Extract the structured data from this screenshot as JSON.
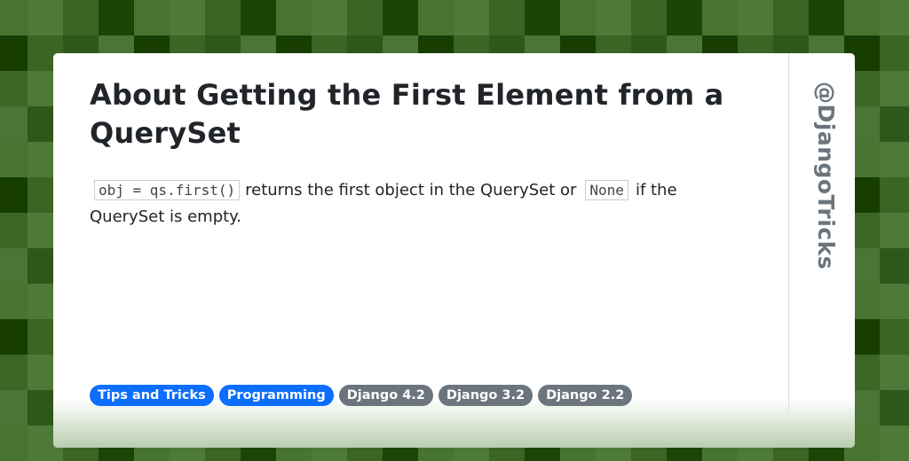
{
  "background": {
    "palette": [
      "#477530",
      "#4d7a38",
      "#3a6525",
      "#1b4407",
      "#173d02",
      "#2f5719",
      "#4a7536",
      "#3b6626"
    ],
    "row_patterns": [
      [
        "#477530",
        "#4d7a38",
        "#3a6525",
        "#1b4407"
      ],
      [
        "#173d02",
        "#3a6525",
        "#2f5719",
        "#4a7536"
      ],
      [
        "#3b6626",
        "#4d7a38",
        "#477530",
        "#2f5719"
      ],
      [
        "#4a7536",
        "#2f5719",
        "#173d02",
        "#3b6626"
      ]
    ]
  },
  "post": {
    "title": "About Getting the First Element from a QuerySet",
    "body": {
      "code1": "obj = qs.first()",
      "text1": "returns the first object in the QuerySet or",
      "code2": "None",
      "text2": "if the QuerySet is empty."
    },
    "tags": [
      {
        "label": "Tips and Tricks",
        "color": "#0d6efd"
      },
      {
        "label": "Programming",
        "color": "#0d6efd"
      },
      {
        "label": "Django 4.2",
        "color": "#6c757d"
      },
      {
        "label": "Django 3.2",
        "color": "#6c757d"
      },
      {
        "label": "Django 2.2",
        "color": "#6c757d"
      }
    ]
  },
  "sidebar": {
    "handle": "@DjangoTricks"
  },
  "colors": {
    "title": "#212529",
    "handle": "#6c757d",
    "tag_primary": "#0d6efd",
    "tag_secondary": "#6c757d"
  }
}
